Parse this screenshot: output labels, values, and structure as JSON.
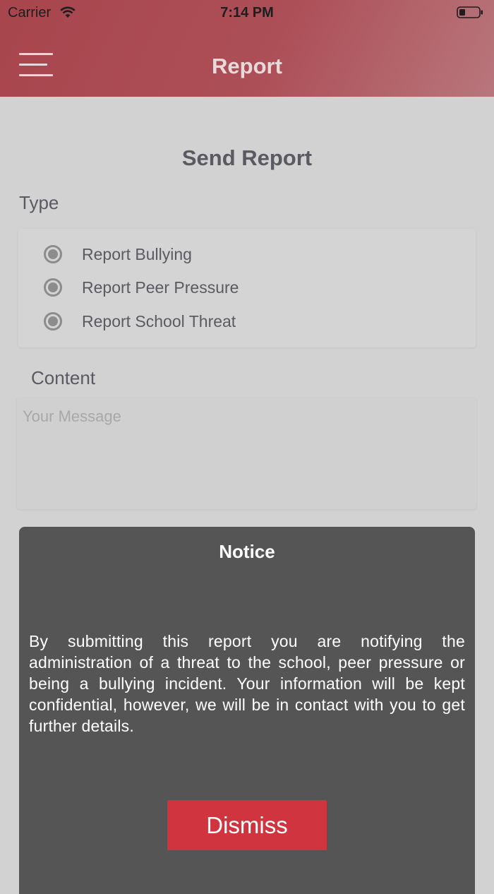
{
  "status_bar": {
    "carrier": "Carrier",
    "time": "7:14 PM"
  },
  "header": {
    "title": "Report",
    "menu_icon": "hamburger-menu-icon"
  },
  "form": {
    "title": "Send Report",
    "type_label": "Type",
    "options": [
      {
        "label": "Report Bullying"
      },
      {
        "label": "Report Peer Pressure"
      },
      {
        "label": "Report School Threat"
      }
    ],
    "content_label": "Content",
    "message_placeholder": "Your Message",
    "message_value": ""
  },
  "notice": {
    "title": "Notice",
    "body": "By submitting this report you are notifying the administration of a threat to the school, peer pressure or being a bullying incident. Your information will be kept confidential, however, we will be in contact with you to get further details.",
    "dismiss_label": "Dismiss"
  },
  "colors": {
    "header": "#ad4f57",
    "background": "#d2d2d2",
    "notice_background": "#555555",
    "dismiss_button": "#d0343f"
  }
}
